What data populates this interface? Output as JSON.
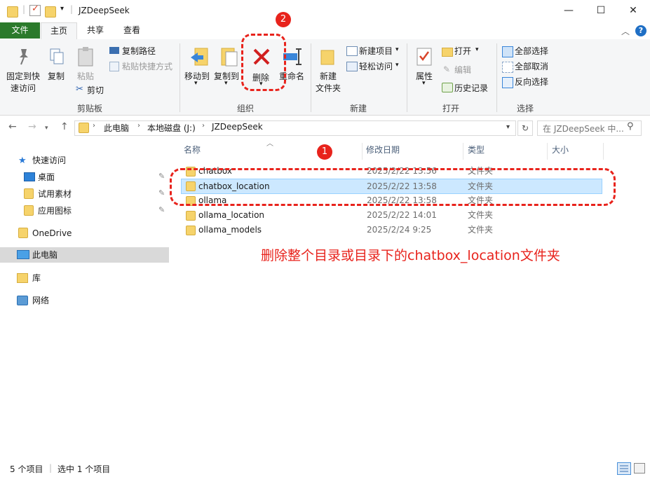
{
  "window": {
    "title": "JZDeepSeek",
    "controls": {
      "minimize": "—",
      "maximize": "☐",
      "close": "✕"
    }
  },
  "tabs": {
    "file": "文件",
    "home": "主页",
    "share": "共享",
    "view": "查看"
  },
  "ribbon": {
    "clipboard": {
      "pin": "固定到快",
      "pin2": "速访问",
      "copy": "复制",
      "paste": "粘贴",
      "copy_path": "复制路径",
      "paste_shortcut": "粘贴快捷方式",
      "cut": "剪切",
      "label": "剪贴板"
    },
    "organize": {
      "move_to": "移动到",
      "copy_to": "复制到",
      "delete": "删除",
      "rename": "重命名",
      "label": "组织"
    },
    "new": {
      "new_folder": "新建",
      "new_folder2": "文件夹",
      "new_item": "新建项目",
      "easy_access": "轻松访问",
      "label": "新建"
    },
    "open": {
      "properties": "属性",
      "open": "打开",
      "edit": "编辑",
      "history": "历史记录",
      "label": "打开"
    },
    "select": {
      "select_all": "全部选择",
      "select_none": "全部取消",
      "invert": "反向选择",
      "label": "选择"
    }
  },
  "address": {
    "crumbs": [
      "此电脑",
      "本地磁盘 (J:)",
      "JZDeepSeek"
    ],
    "search_placeholder": "在 JZDeepSeek 中..."
  },
  "nav": {
    "quick_access": "快速访问",
    "desktop": "桌面",
    "trial": "试用素材",
    "app_icons": "应用图标",
    "onedrive": "OneDrive",
    "this_pc": "此电脑",
    "library": "库",
    "network": "网络"
  },
  "columns": {
    "name": "名称",
    "modified": "修改日期",
    "type": "类型",
    "size": "大小"
  },
  "files": [
    {
      "name": "chatbox",
      "modified": "2025/2/22 13:56",
      "type": "文件夹"
    },
    {
      "name": "chatbox_location",
      "modified": "2025/2/22 13:58",
      "type": "文件夹"
    },
    {
      "name": "ollama",
      "modified": "2025/2/22 13:58",
      "type": "文件夹"
    },
    {
      "name": "ollama_location",
      "modified": "2025/2/22 14:01",
      "type": "文件夹"
    },
    {
      "name": "ollama_models",
      "modified": "2025/2/24 9:25",
      "type": "文件夹"
    }
  ],
  "annotation": {
    "text": "删除整个目录或目录下的chatbox_location文件夹",
    "marker1": "1",
    "marker2": "2",
    "color": "#e8231c"
  },
  "status": {
    "count": "5 个项目",
    "selected": "选中 1 个项目"
  }
}
